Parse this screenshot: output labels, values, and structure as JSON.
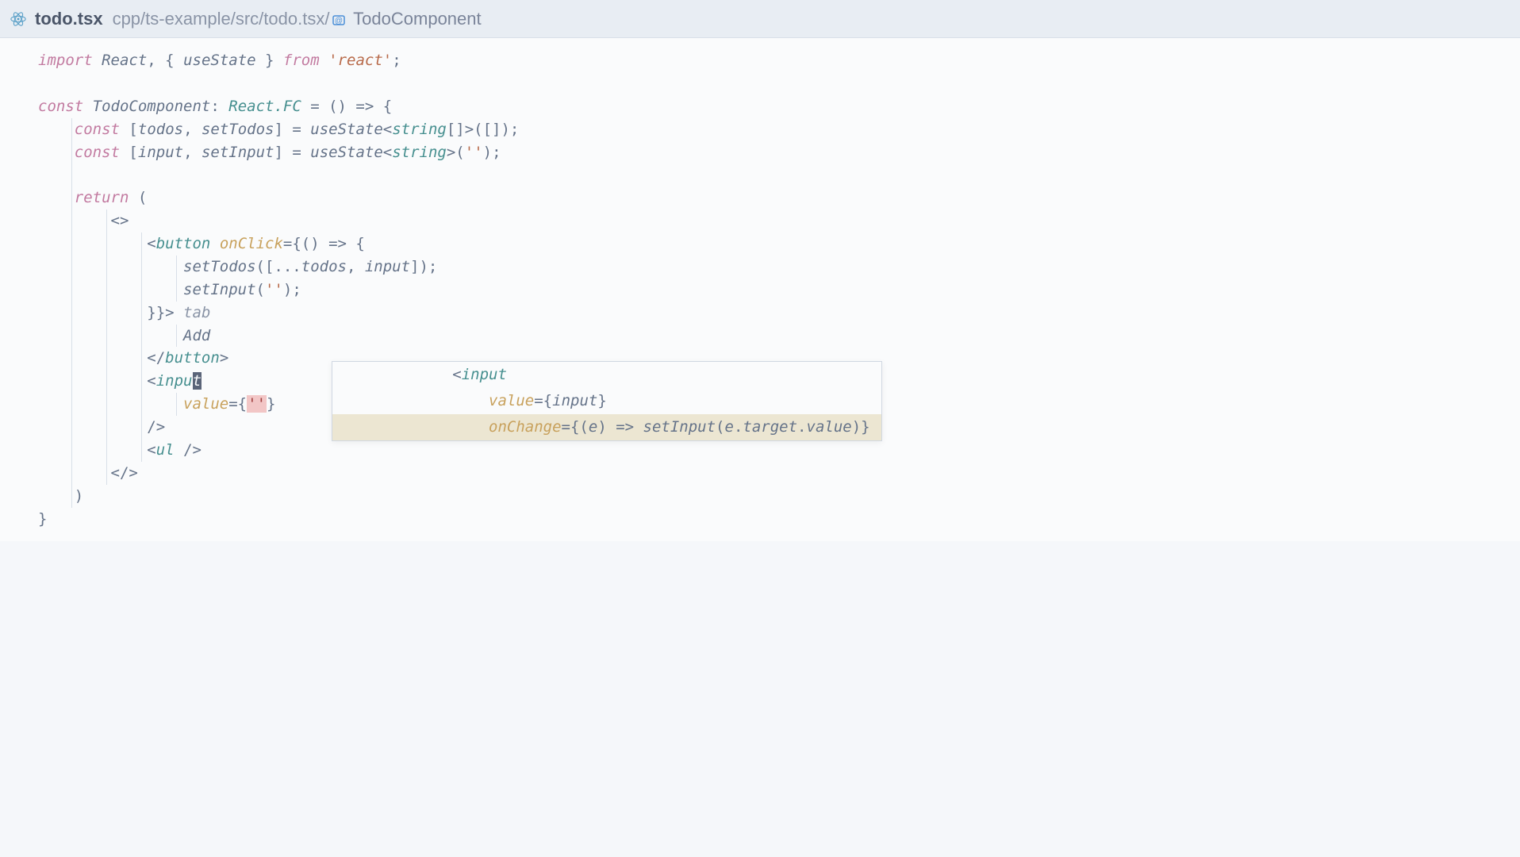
{
  "titlebar": {
    "filename": "todo.tsx",
    "breadcrumb_path": "cpp/ts-example/src/todo.tsx/",
    "symbol_name": "TodoComponent"
  },
  "code": {
    "l1_import": "import",
    "l1_react": "React",
    "l1_usestate": "useState",
    "l1_from": "from",
    "l1_reactstr": "'react'",
    "l3_const": "const",
    "l3_name": "TodoComponent",
    "l3_reactfc": "React.FC",
    "l4_const": "const",
    "l4_todos": "todos",
    "l4_settodos": "setTodos",
    "l4_usestate": "useState",
    "l4_string": "string",
    "l5_const": "const",
    "l5_input": "input",
    "l5_setinput": "setInput",
    "l5_usestate": "useState",
    "l5_string": "string",
    "l7_return": "return",
    "l9_button": "button",
    "l9_onclick": "onClick",
    "l10_settodos": "setTodos",
    "l10_todos": "todos",
    "l10_input": "input",
    "l11_setinput": "setInput",
    "l12_tab": "tab",
    "l13_add": "Add",
    "l14_button": "button",
    "l15_input_pre": "inpu",
    "l15_input_cursor": "t",
    "l16_value": "value",
    "l16_err": "''",
    "l18_ul": "ul"
  },
  "suggest": {
    "s1_input": "input",
    "s2_value": "value",
    "s2_inputvar": "input",
    "s3_onchange": "onChange",
    "s3_e": "e",
    "s3_setinput": "setInput",
    "s3_target": "target",
    "s3_value": "value"
  },
  "colors": {
    "keyword": "#c27aa0",
    "type": "#468f8f",
    "attr": "#c8a15c",
    "string": "#b86a4a",
    "bg": "#fafbfc",
    "titlebar": "#e8edf3"
  }
}
